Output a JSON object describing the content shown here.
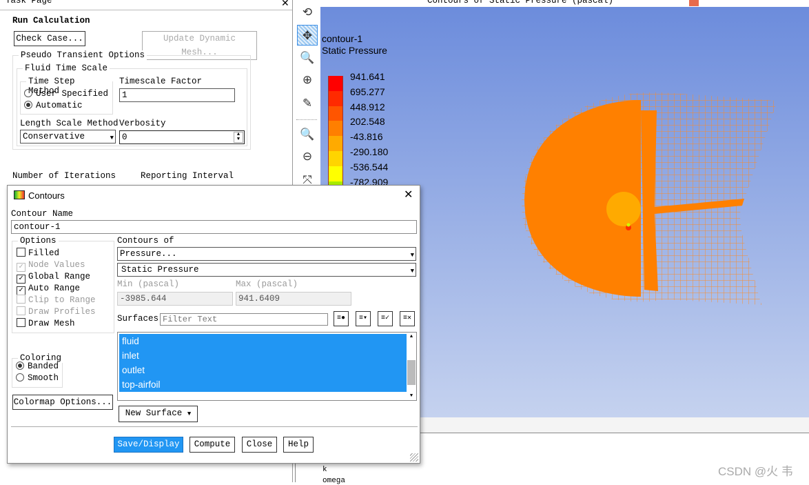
{
  "task_page": {
    "title": "Task Page",
    "section_title": "Run Calculation",
    "check_case": "Check Case...",
    "update_mesh": "Update Dynamic Mesh...",
    "pseudo_group": "Pseudo Transient Options",
    "fluid_group": "Fluid Time Scale",
    "time_step_group": "Time Step Method",
    "user_specified": "User Specified",
    "automatic": "Automatic",
    "time_step_selected": "Automatic",
    "timescale_label": "Timescale Factor",
    "timescale_value": "1",
    "length_scale_label": "Length Scale Method",
    "length_scale_value": "Conservative",
    "verbosity_label": "Verbosity",
    "verbosity_value": "0",
    "iterations_label": "Number of Iterations",
    "reporting_label": "Reporting Interval"
  },
  "graphics": {
    "window_title": "Contours of Static Pressure (pascal)",
    "legend_title": "contour-1",
    "legend_subtitle": "Static Pressure",
    "legend_levels": [
      "941.641",
      "695.277",
      "448.912",
      "202.548",
      "-43.816",
      "-290.180",
      "-536.544",
      "-782.909"
    ],
    "legend_colors": [
      "#ff0000",
      "#ff2a00",
      "#ff5500",
      "#ff7f00",
      "#ffaa00",
      "#ffd400",
      "#ffff00",
      "#aaee00"
    ]
  },
  "toolbar": {
    "icons": [
      "rotate-icon",
      "pan-icon",
      "zoom-fit-icon",
      "zoom-in-icon",
      "probe-icon",
      "zoom-box-icon",
      "zoom-out-icon",
      "axes-icon"
    ],
    "active": "pan-icon"
  },
  "console": {
    "lines": [
      "k",
      "omega"
    ]
  },
  "watermark": "CSDN @火 韦",
  "dialog": {
    "title": "Contours",
    "contour_name_label": "Contour Name",
    "contour_name": "contour-1",
    "options_label": "Options",
    "options": [
      {
        "label": "Filled",
        "checked": false,
        "disabled": false
      },
      {
        "label": "Node Values",
        "checked": true,
        "disabled": true
      },
      {
        "label": "Global Range",
        "checked": true,
        "disabled": false
      },
      {
        "label": "Auto Range",
        "checked": true,
        "disabled": false
      },
      {
        "label": "Clip to Range",
        "checked": false,
        "disabled": true
      },
      {
        "label": "Draw Profiles",
        "checked": false,
        "disabled": true
      },
      {
        "label": "Draw Mesh",
        "checked": false,
        "disabled": false
      }
    ],
    "contours_of_label": "Contours of",
    "contours_of": "Pressure...",
    "contours_sub": "Static Pressure",
    "min_label": "Min (pascal)",
    "min_value": "-3985.644",
    "max_label": "Max (pascal)",
    "max_value": "941.6409",
    "surfaces_label": "Surfaces",
    "filter_placeholder": "Filter Text",
    "surfaces": [
      "fluid",
      "inlet",
      "outlet",
      "top-airfoil"
    ],
    "coloring_label": "Coloring",
    "banded": "Banded",
    "smooth": "Smooth",
    "coloring_selected": "Banded",
    "colormap_button": "Colormap Options...",
    "new_surface": "New Surface",
    "save_display": "Save/Display",
    "compute": "Compute",
    "close": "Close",
    "help": "Help",
    "accent": "#2196f3"
  }
}
